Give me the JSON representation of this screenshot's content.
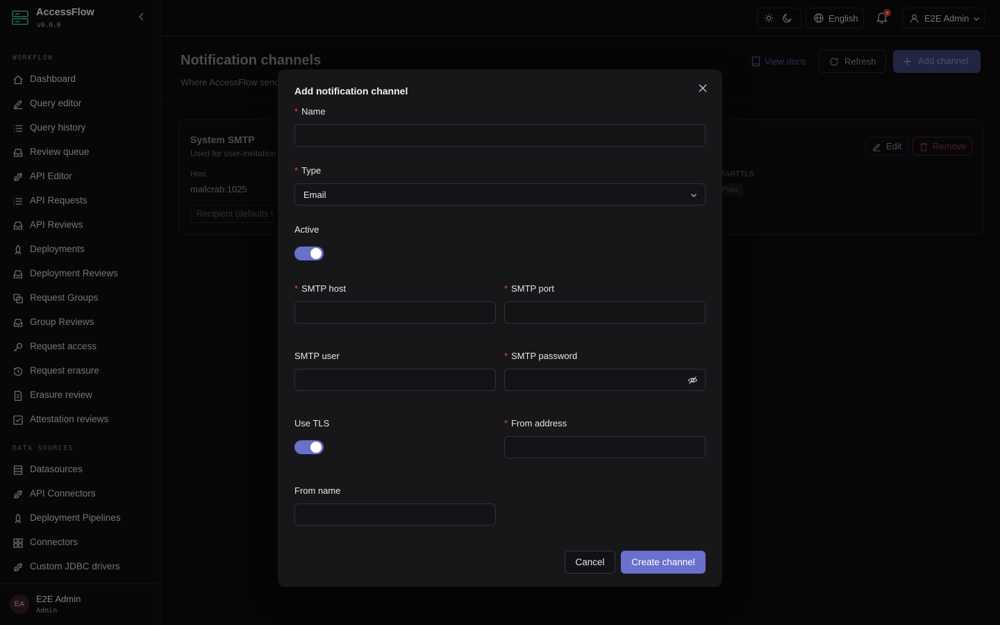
{
  "app": {
    "name": "AccessFlow",
    "version": "v0.0.0"
  },
  "sidebar": {
    "sections": [
      {
        "label": "WORKFLOW",
        "items": [
          {
            "label": "Dashboard",
            "icon": "home-icon"
          },
          {
            "label": "Query editor",
            "icon": "pencil-icon"
          },
          {
            "label": "Query history",
            "icon": "list-icon"
          },
          {
            "label": "Review queue",
            "icon": "inbox-icon"
          },
          {
            "label": "API Editor",
            "icon": "plug-icon"
          },
          {
            "label": "API Requests",
            "icon": "list-icon"
          },
          {
            "label": "API Reviews",
            "icon": "inbox-icon"
          },
          {
            "label": "Deployments",
            "icon": "rocket-icon"
          },
          {
            "label": "Deployment Reviews",
            "icon": "inbox-icon"
          },
          {
            "label": "Request Groups",
            "icon": "group-icon"
          },
          {
            "label": "Group Reviews",
            "icon": "inbox-icon"
          },
          {
            "label": "Request access",
            "icon": "key-icon"
          },
          {
            "label": "Request erasure",
            "icon": "history-icon"
          },
          {
            "label": "Erasure review",
            "icon": "document-icon"
          },
          {
            "label": "Attestation reviews",
            "icon": "checkbox-icon"
          }
        ]
      },
      {
        "label": "DATA SOURCES",
        "items": [
          {
            "label": "Datasources",
            "icon": "database-icon"
          },
          {
            "label": "API Connectors",
            "icon": "plug-icon"
          },
          {
            "label": "Deployment Pipelines",
            "icon": "rocket-icon"
          },
          {
            "label": "Connectors",
            "icon": "grid-icon"
          },
          {
            "label": "Custom JDBC drivers",
            "icon": "plug-icon"
          }
        ]
      }
    ],
    "user": {
      "initials": "EA",
      "name": "E2E Admin",
      "role": "Admin"
    }
  },
  "header": {
    "language": "English",
    "notification_count": "8",
    "user_label": "E2E Admin"
  },
  "page": {
    "title": "Notification channels",
    "description": "Where AccessFlow send",
    "docs_label": "View docs",
    "refresh_label": "Refresh",
    "add_label": "Add channel"
  },
  "channel_card": {
    "name": "System SMTP",
    "description": "Used for user-invitation",
    "host_label": "Host",
    "host_value": "mailcrab:1025",
    "recipient_placeholder": "Recipient (defaults t",
    "tls_label": "TARTTLS",
    "tls_value": "Plain",
    "edit_label": "Edit",
    "remove_label": "Remove"
  },
  "modal": {
    "title": "Add notification channel",
    "fields": {
      "name": {
        "label": "Name",
        "value": ""
      },
      "type": {
        "label": "Type",
        "value": "Email"
      },
      "active": {
        "label": "Active",
        "on": true
      },
      "smtp_host": {
        "label": "SMTP host",
        "value": ""
      },
      "smtp_port": {
        "label": "SMTP port",
        "value": ""
      },
      "smtp_user": {
        "label": "SMTP user",
        "value": ""
      },
      "smtp_password": {
        "label": "SMTP password",
        "value": ""
      },
      "use_tls": {
        "label": "Use TLS",
        "on": true
      },
      "from_address": {
        "label": "From address",
        "value": ""
      },
      "from_name": {
        "label": "From name",
        "value": ""
      }
    },
    "required_marker": "*",
    "cancel_label": "Cancel",
    "submit_label": "Create channel"
  },
  "colors": {
    "accent": "#6a70cc",
    "required": "#e5484d",
    "danger": "#8e3232",
    "background": "#0b0b0d",
    "modal_background": "#17171a"
  }
}
